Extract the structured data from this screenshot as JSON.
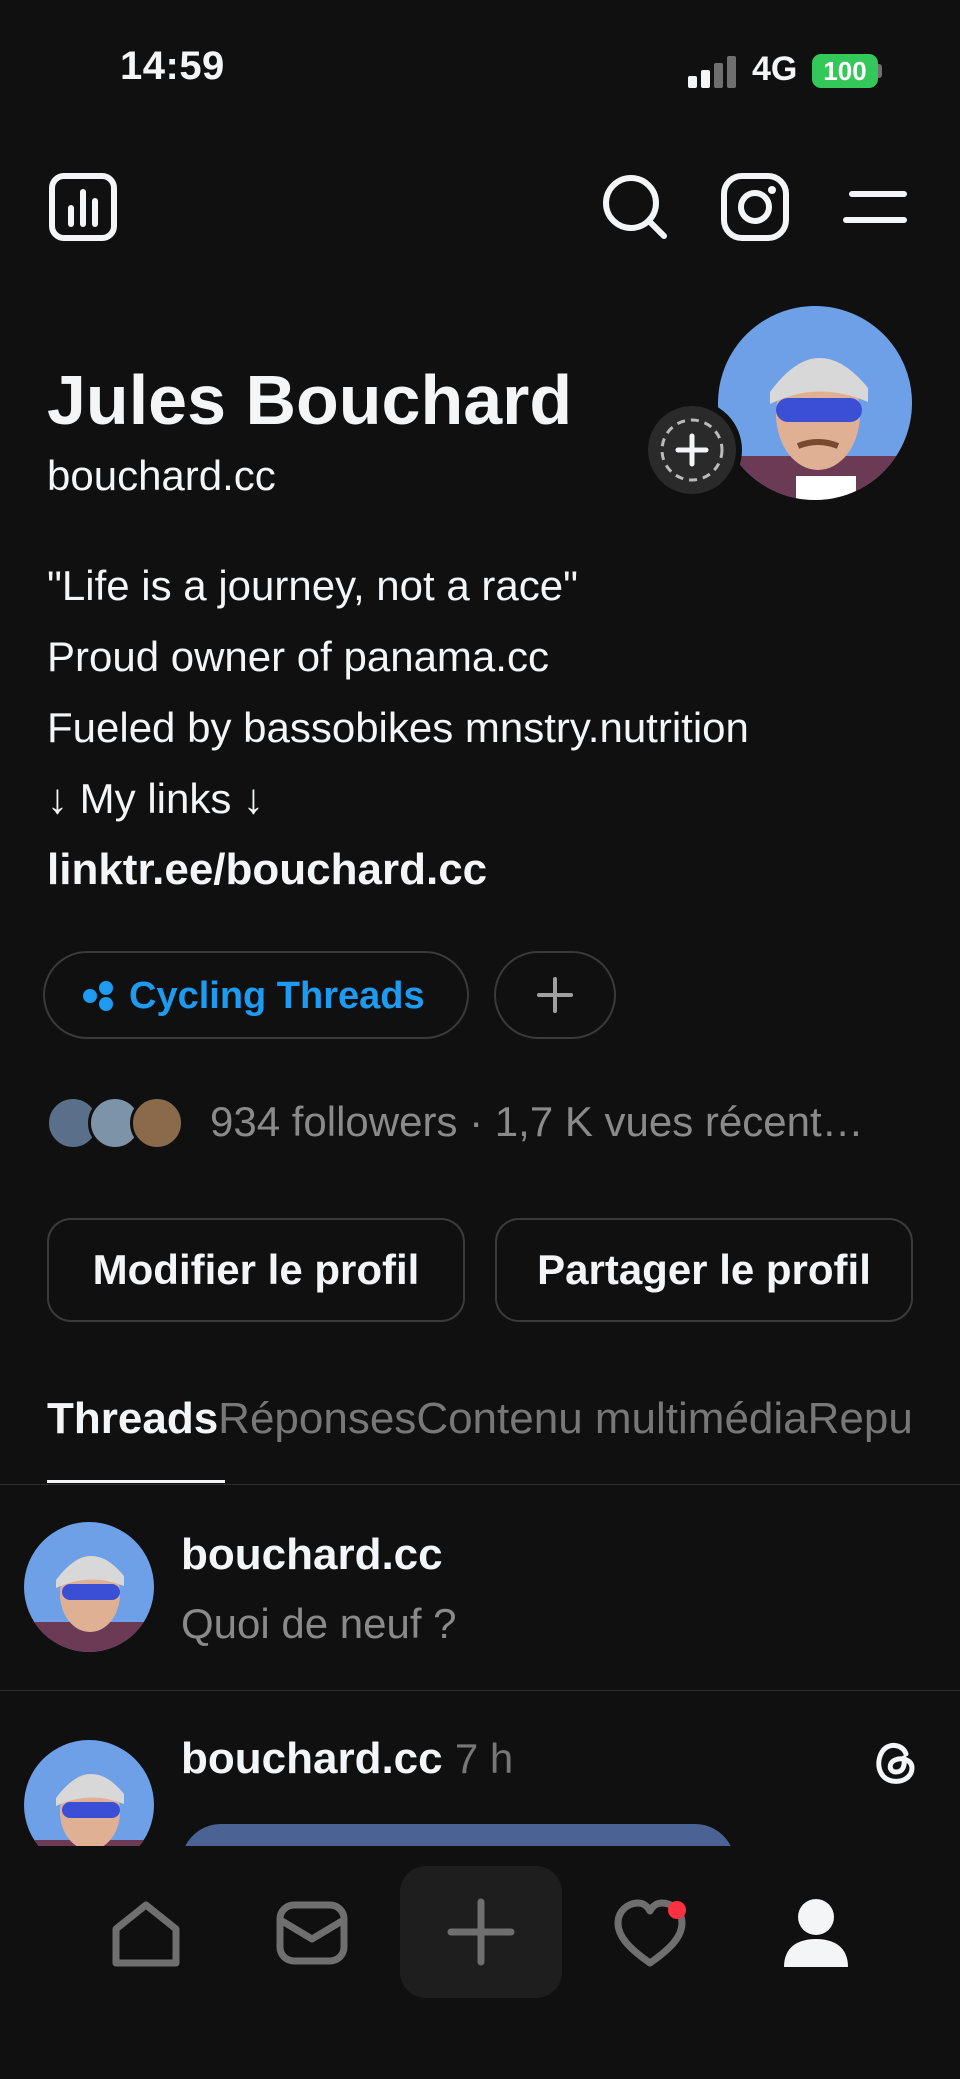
{
  "status_bar": {
    "time": "14:59",
    "network": "4G",
    "battery": "100"
  },
  "top_bar": {
    "icons": [
      "insights-icon",
      "search-icon",
      "instagram-icon",
      "menu-icon"
    ]
  },
  "profile": {
    "name": "Jules Bouchard",
    "handle": "bouchard.cc",
    "bio_lines": [
      "\"Life is a journey, not a race\"",
      "Proud owner of panama.cc",
      "Fueled by bassobikes mnstry.nutrition",
      "↓ My links ↓"
    ],
    "link": "linktr.ee/bouchard.cc",
    "community_chip": "Cycling Threads",
    "followers_text": "934 followers · 1,7 K vues récent…"
  },
  "buttons": {
    "edit": "Modifier le profil",
    "share": "Partager le profil"
  },
  "tabs": [
    "Threads",
    "Réponses",
    "Contenu multimédia",
    "Repu"
  ],
  "compose": {
    "username": "bouchard.cc",
    "placeholder": "Quoi de neuf ?"
  },
  "post": {
    "username": "bouchard.cc",
    "time": "7 h"
  },
  "colors": {
    "background": "#101010",
    "accent": "#1d9bf0",
    "battery": "#34c759",
    "notification_dot": "#ff3040"
  }
}
